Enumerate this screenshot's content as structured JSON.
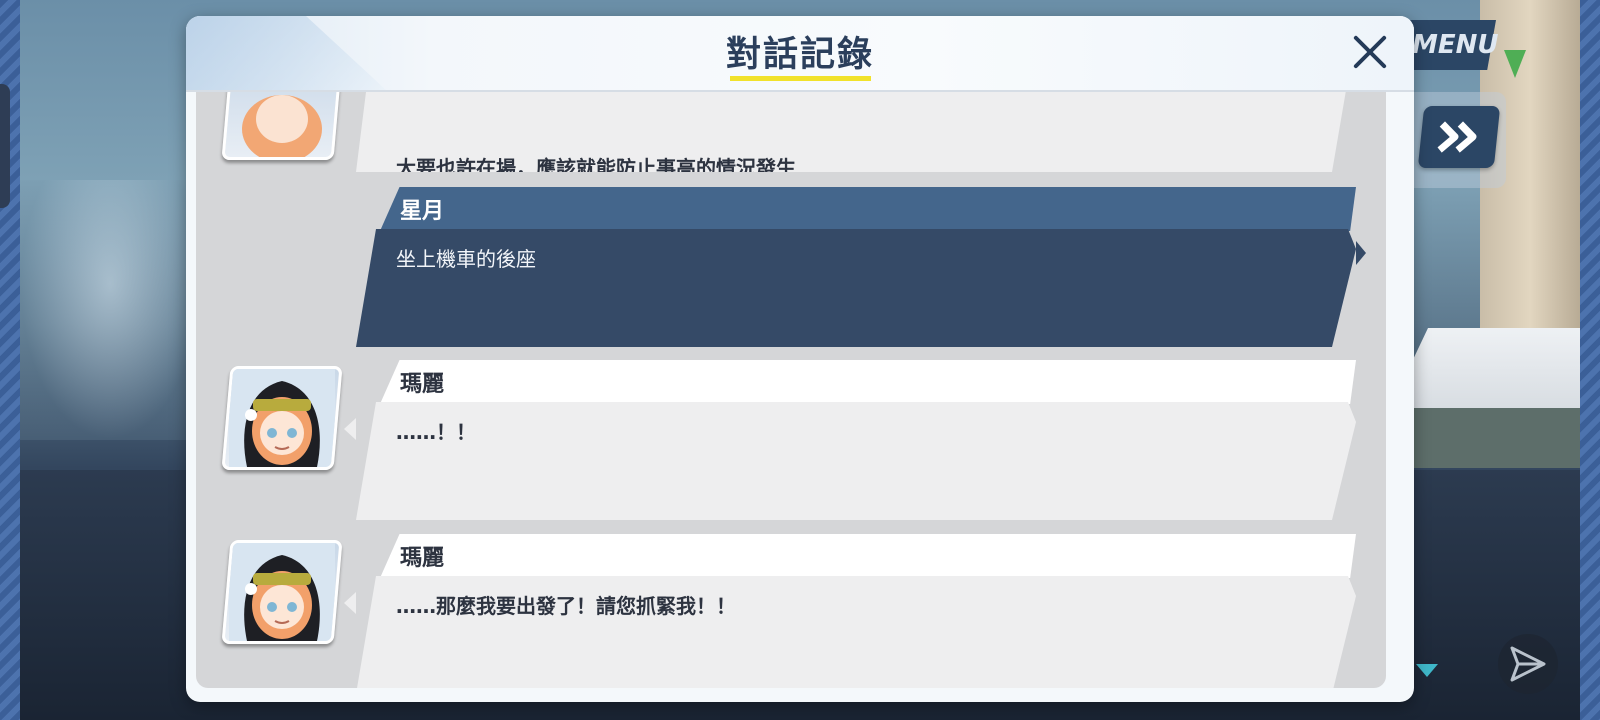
{
  "scene": {
    "menu_label": "MENU",
    "fast_forward_icon": "double-chevron-right-icon",
    "send_icon": "paper-plane-icon",
    "scroll_indicator_icon": "triangle-down-icon",
    "colors": {
      "accent_cyan": "#3fb7c9",
      "panel_navy": "#2b4665"
    }
  },
  "dialog": {
    "title": "對話記錄",
    "close_icon": "close-icon",
    "colors": {
      "title_underline": "#f1e22b",
      "player_bubble": "#354a67",
      "npc_bubble": "#eeeeef"
    }
  },
  "log": {
    "entries": [
      {
        "speaker": "",
        "text": "大要也許在場，應該就能防止事高的情況發生",
        "side": "npc",
        "partial": true
      },
      {
        "speaker": "星月",
        "text": "坐上機車的後座",
        "side": "player"
      },
      {
        "speaker": "瑪麗",
        "text": "……！！",
        "side": "npc"
      },
      {
        "speaker": "瑪麗",
        "text": "……那麼我要出發了！請您抓緊我！！",
        "side": "npc"
      }
    ]
  }
}
